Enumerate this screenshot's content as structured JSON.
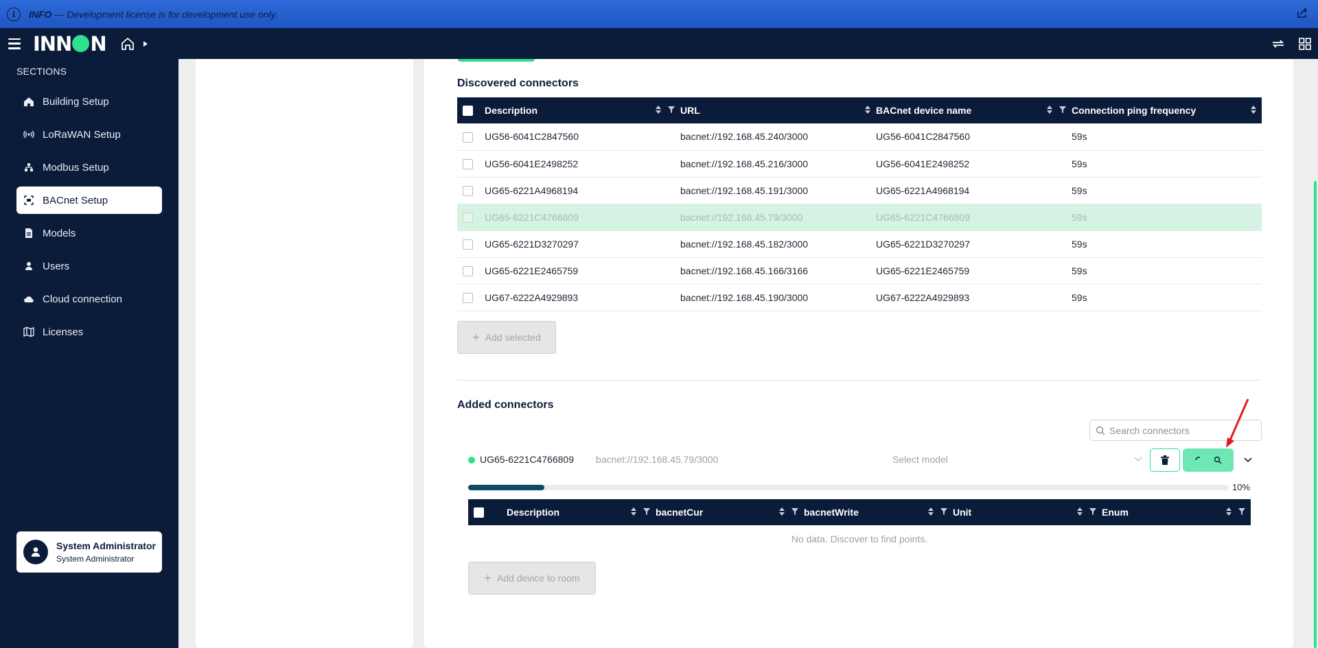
{
  "infobar": {
    "label": "INFO",
    "separator": " — ",
    "message": "Development license is for development use only."
  },
  "header": {
    "logo_pre": "INN",
    "logo_post": "N"
  },
  "sidebar": {
    "section_title": "SECTIONS",
    "items": [
      {
        "label": "Building Setup",
        "icon": "home-icon"
      },
      {
        "label": "LoRaWAN Setup",
        "icon": "signal-icon"
      },
      {
        "label": "Modbus Setup",
        "icon": "network-icon"
      },
      {
        "label": "BACnet Setup",
        "icon": "bacnet-icon",
        "active": true
      },
      {
        "label": "Models",
        "icon": "models-icon"
      },
      {
        "label": "Users",
        "icon": "user-icon"
      },
      {
        "label": "Cloud connection",
        "icon": "cloud-icon"
      },
      {
        "label": "Licenses",
        "icon": "map-icon"
      }
    ],
    "user": {
      "name": "System Administrator",
      "role": "System Administrator"
    }
  },
  "discovered": {
    "title": "Discovered connectors",
    "columns": [
      "Description",
      "URL",
      "BACnet device name",
      "Connection ping frequency"
    ],
    "rows": [
      {
        "description": "UG56-6041C2847560",
        "url": "bacnet://192.168.45.240/3000",
        "device": "UG56-6041C2847560",
        "ping": "59s"
      },
      {
        "description": "UG56-6041E2498252",
        "url": "bacnet://192.168.45.216/3000",
        "device": "UG56-6041E2498252",
        "ping": "59s"
      },
      {
        "description": "UG65-6221A4968194",
        "url": "bacnet://192.168.45.191/3000",
        "device": "UG65-6221A4968194",
        "ping": "59s"
      },
      {
        "description": "UG65-6221C4766809",
        "url": "bacnet://192.168.45.79/3000",
        "device": "UG65-6221C4766809",
        "ping": "59s",
        "highlighted": true
      },
      {
        "description": "UG65-6221D3270297",
        "url": "bacnet://192.168.45.182/3000",
        "device": "UG65-6221D3270297",
        "ping": "59s"
      },
      {
        "description": "UG65-6221E2465759",
        "url": "bacnet://192.168.45.166/3166",
        "device": "UG65-6221E2465759",
        "ping": "59s"
      },
      {
        "description": "UG67-6222A4929893",
        "url": "bacnet://192.168.45.190/3000",
        "device": "UG67-6222A4929893",
        "ping": "59s"
      }
    ],
    "add_selected_label": "Add selected"
  },
  "added": {
    "title": "Added connectors",
    "search_placeholder": "Search connectors",
    "connector": {
      "name": "UG65-6221C4766809",
      "url": "bacnet://192.168.45.79/3000",
      "model_placeholder": "Select model"
    },
    "progress": {
      "value": 0.1,
      "label": "10%"
    },
    "points_columns": [
      "Description",
      "bacnetCur",
      "bacnetWrite",
      "Unit",
      "Enum"
    ],
    "empty_message": "No data. Discover to find points.",
    "add_device_label": "Add device to room"
  },
  "colors": {
    "navy": "#0b1b3a",
    "accent": "#2fe08f",
    "highlight": "#d4f3e2",
    "info": "#2d6bd8"
  }
}
